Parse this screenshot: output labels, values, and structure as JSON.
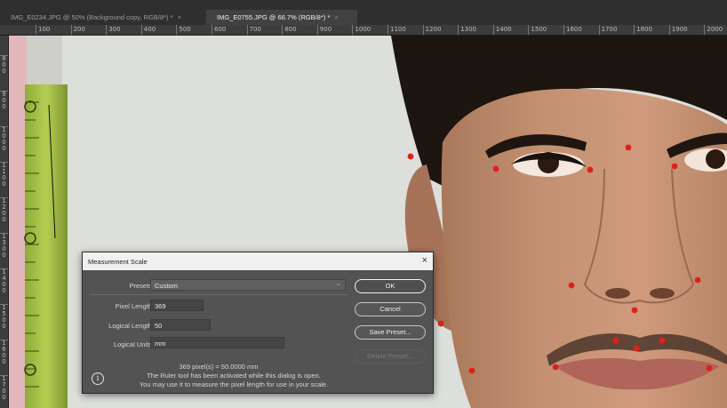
{
  "tabs": [
    {
      "label": "IMG_E0234.JPG @ 50% (Background copy, RGB/8*) *",
      "close": "×",
      "active": false
    },
    {
      "label": "IMG_E0755.JPG @ 66.7% (RGB/8*) *",
      "close": "×",
      "active": true
    }
  ],
  "ruler_top": [
    "100",
    "200",
    "300",
    "400",
    "500",
    "600",
    "700",
    "800",
    "900",
    "1000",
    "1100",
    "1200",
    "1300",
    "1400",
    "1500",
    "1600",
    "1700",
    "1800",
    "1900",
    "2000"
  ],
  "ruler_left": [
    "800",
    "900",
    "1000",
    "1100",
    "1200",
    "1300",
    "1400",
    "1500",
    "1600",
    "1700"
  ],
  "dialog": {
    "title": "Measurement Scale",
    "close": "×",
    "presets_label": "Presets:",
    "presets_value": "Custom",
    "pixel_length_label": "Pixel Length:",
    "pixel_length_value": "369",
    "logical_length_label": "Logical Length:",
    "logical_length_value": "50",
    "logical_units_label": "Logical Units:",
    "logical_units_value": "mm",
    "equation": "369 pixel(s) = 50.0000 mm",
    "info_icon": "i",
    "info_line1": "The Ruler tool has been activated while this dialog is open.",
    "info_line2": "You may use it to measure the pixel length for use in your scale.",
    "buttons": {
      "ok": "OK",
      "cancel": "Cancel",
      "save_preset": "Save Preset...",
      "delete_preset": "Delete Preset..."
    }
  },
  "colors": {
    "landmark": "#e0201b",
    "panel": "#535353",
    "chrome": "#2f2f2f"
  }
}
